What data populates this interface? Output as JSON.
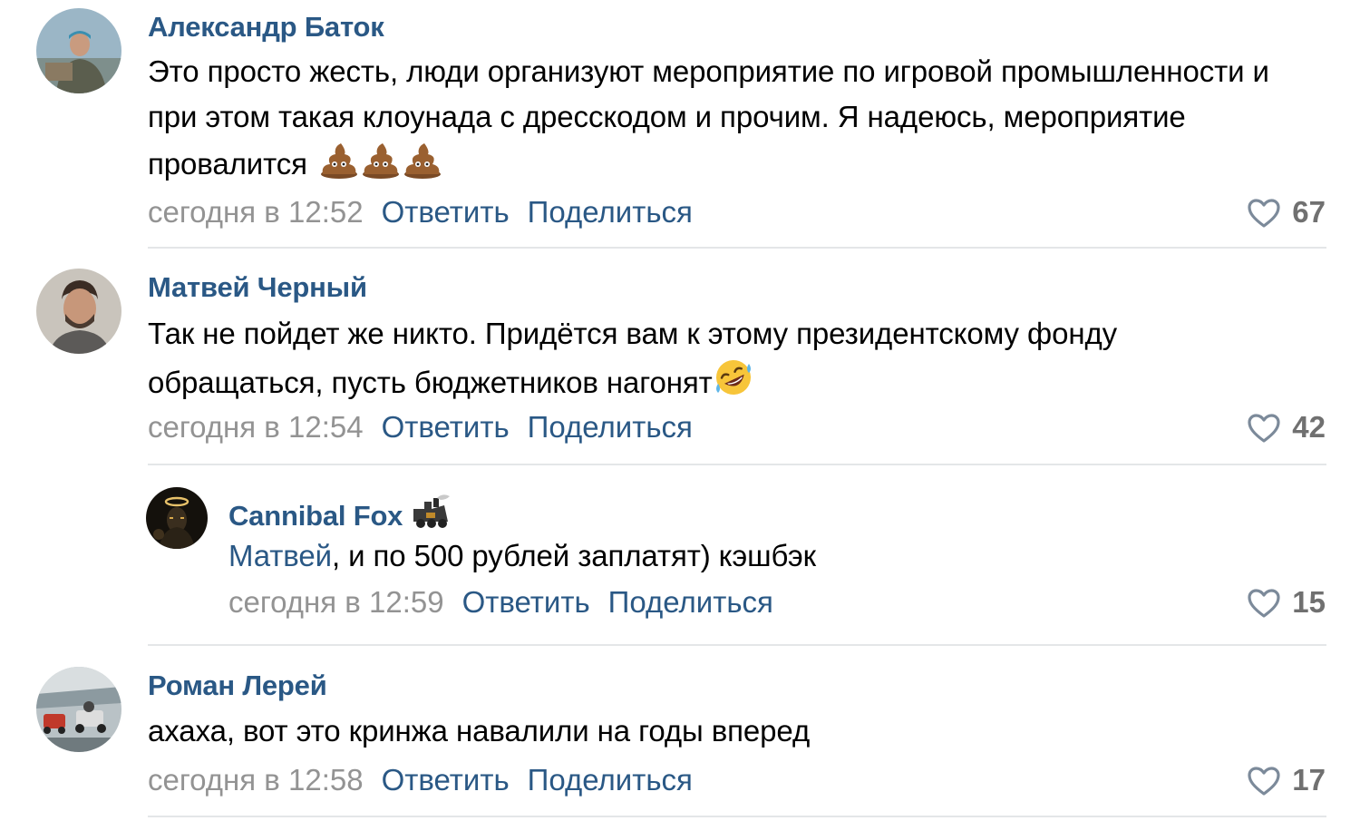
{
  "comments": [
    {
      "author": "Александр Баток",
      "text": "Это просто жесть, люди организуют мероприятие по игровой промышленности и при этом такая клоунада с дресскодом и прочим. Я надеюсь, мероприятие провалится",
      "emoji": [
        "poop-emoji",
        "poop-emoji",
        "poop-emoji"
      ],
      "date": "сегодня в 12:52",
      "reply_label": "Ответить",
      "share_label": "Поделиться",
      "likes": "67"
    },
    {
      "author": "Матвей Черный",
      "text": "Так не пойдет же никто. Придётся вам к этому президентскому фонду обращаться, пусть бюджетников нагонят",
      "emoji": [
        "rolling-laughing-emoji"
      ],
      "date": "сегодня в 12:54",
      "reply_label": "Ответить",
      "share_label": "Поделиться",
      "likes": "42"
    },
    {
      "author": "Cannibal Fox",
      "author_badge": "locomotive-icon",
      "mention": "Матвей",
      "text": ", и по 500 рублей заплатят) кэшбэк",
      "date": "сегодня в 12:59",
      "reply_label": "Ответить",
      "share_label": "Поделиться",
      "likes": "15"
    },
    {
      "author": "Роман Лерей",
      "text": "ахаха, вот это кринжа навалили на годы вперед",
      "date": "сегодня в 12:58",
      "reply_label": "Ответить",
      "share_label": "Поделиться",
      "likes": "17"
    }
  ],
  "colors": {
    "link": "#2a5885",
    "meta": "#939393",
    "likes": "#707070",
    "divider": "#e4e6e8"
  }
}
